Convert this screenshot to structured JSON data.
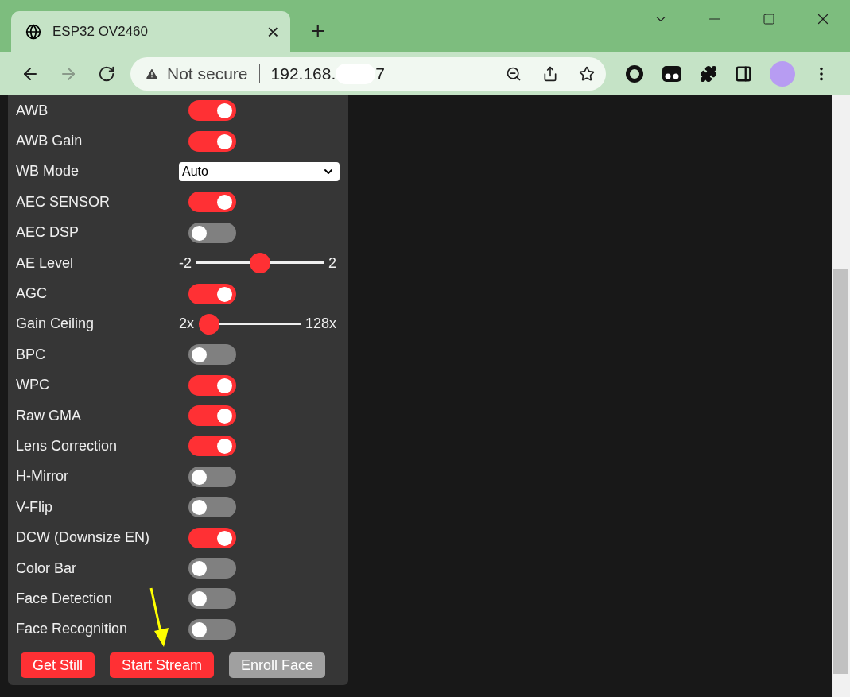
{
  "tab": {
    "title": "ESP32 OV2460",
    "close": "×",
    "new_tab": "+"
  },
  "address_bar": {
    "security": "Not secure",
    "address_start": "192.168.",
    "address_end": "7"
  },
  "controls": [
    {
      "kind": "toggle",
      "label": "AWB",
      "on": true
    },
    {
      "kind": "toggle",
      "label": "AWB Gain",
      "on": true
    },
    {
      "kind": "select",
      "label": "WB Mode",
      "value": "Auto"
    },
    {
      "kind": "toggle",
      "label": "AEC SENSOR",
      "on": true
    },
    {
      "kind": "toggle",
      "label": "AEC DSP",
      "on": false
    },
    {
      "kind": "slider",
      "label": "AE Level",
      "min": "-2",
      "max": "2",
      "level": 0.5
    },
    {
      "kind": "toggle",
      "label": "AGC",
      "on": true
    },
    {
      "kind": "slider",
      "label": "Gain Ceiling",
      "min": "2x",
      "max": "128x",
      "level": 0
    },
    {
      "kind": "toggle",
      "label": "BPC",
      "on": false
    },
    {
      "kind": "toggle",
      "label": "WPC",
      "on": true
    },
    {
      "kind": "toggle",
      "label": "Raw GMA",
      "on": true
    },
    {
      "kind": "toggle",
      "label": "Lens Correction",
      "on": true
    },
    {
      "kind": "toggle",
      "label": "H-Mirror",
      "on": false
    },
    {
      "kind": "toggle",
      "label": "V-Flip",
      "on": false
    },
    {
      "kind": "toggle",
      "label": "DCW (Downsize EN)",
      "on": true
    },
    {
      "kind": "toggle",
      "label": "Color Bar",
      "on": false
    },
    {
      "kind": "toggle",
      "label": "Face Detection",
      "on": false
    },
    {
      "kind": "toggle",
      "label": "Face Recognition",
      "on": false
    }
  ],
  "buttons": [
    {
      "label": "Get Still",
      "disabled": false
    },
    {
      "label": "Start Stream",
      "disabled": false
    },
    {
      "label": "Enroll Face",
      "disabled": true
    }
  ]
}
